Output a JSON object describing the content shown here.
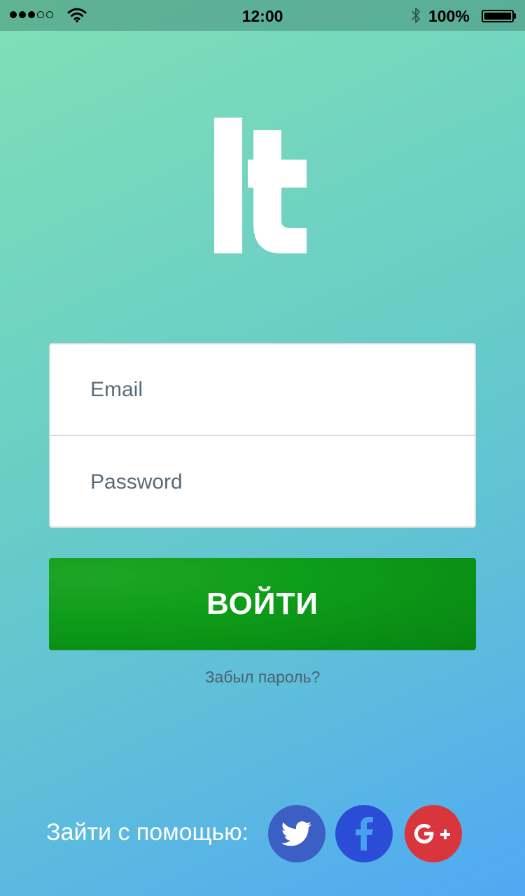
{
  "status_bar": {
    "time": "12:00",
    "battery_percent": "100%",
    "signal_strength": 3,
    "signal_max": 5,
    "icons": [
      "wifi-icon",
      "bluetooth-icon",
      "battery-icon"
    ]
  },
  "logo": {
    "text": "It",
    "color": "#ffffff"
  },
  "form": {
    "email_placeholder": "Email",
    "email_value": "",
    "password_placeholder": "Password",
    "password_value": ""
  },
  "login_button": {
    "label": "ВОЙТИ",
    "color": "#0d9d19"
  },
  "forgot_password": {
    "label": "Забыл пароль?"
  },
  "social": {
    "label": "Зайти с помощью:",
    "providers": [
      {
        "name": "twitter",
        "icon": "twitter-bird-icon",
        "color": "#3b5fc5"
      },
      {
        "name": "facebook",
        "icon": "facebook-f-icon",
        "color": "#2a4cd6"
      },
      {
        "name": "google-plus",
        "icon": "google-plus-icon",
        "color": "#d9353c"
      }
    ]
  },
  "background": {
    "gradient_start": "#7fe0b6",
    "gradient_end": "#4fa9f3"
  }
}
